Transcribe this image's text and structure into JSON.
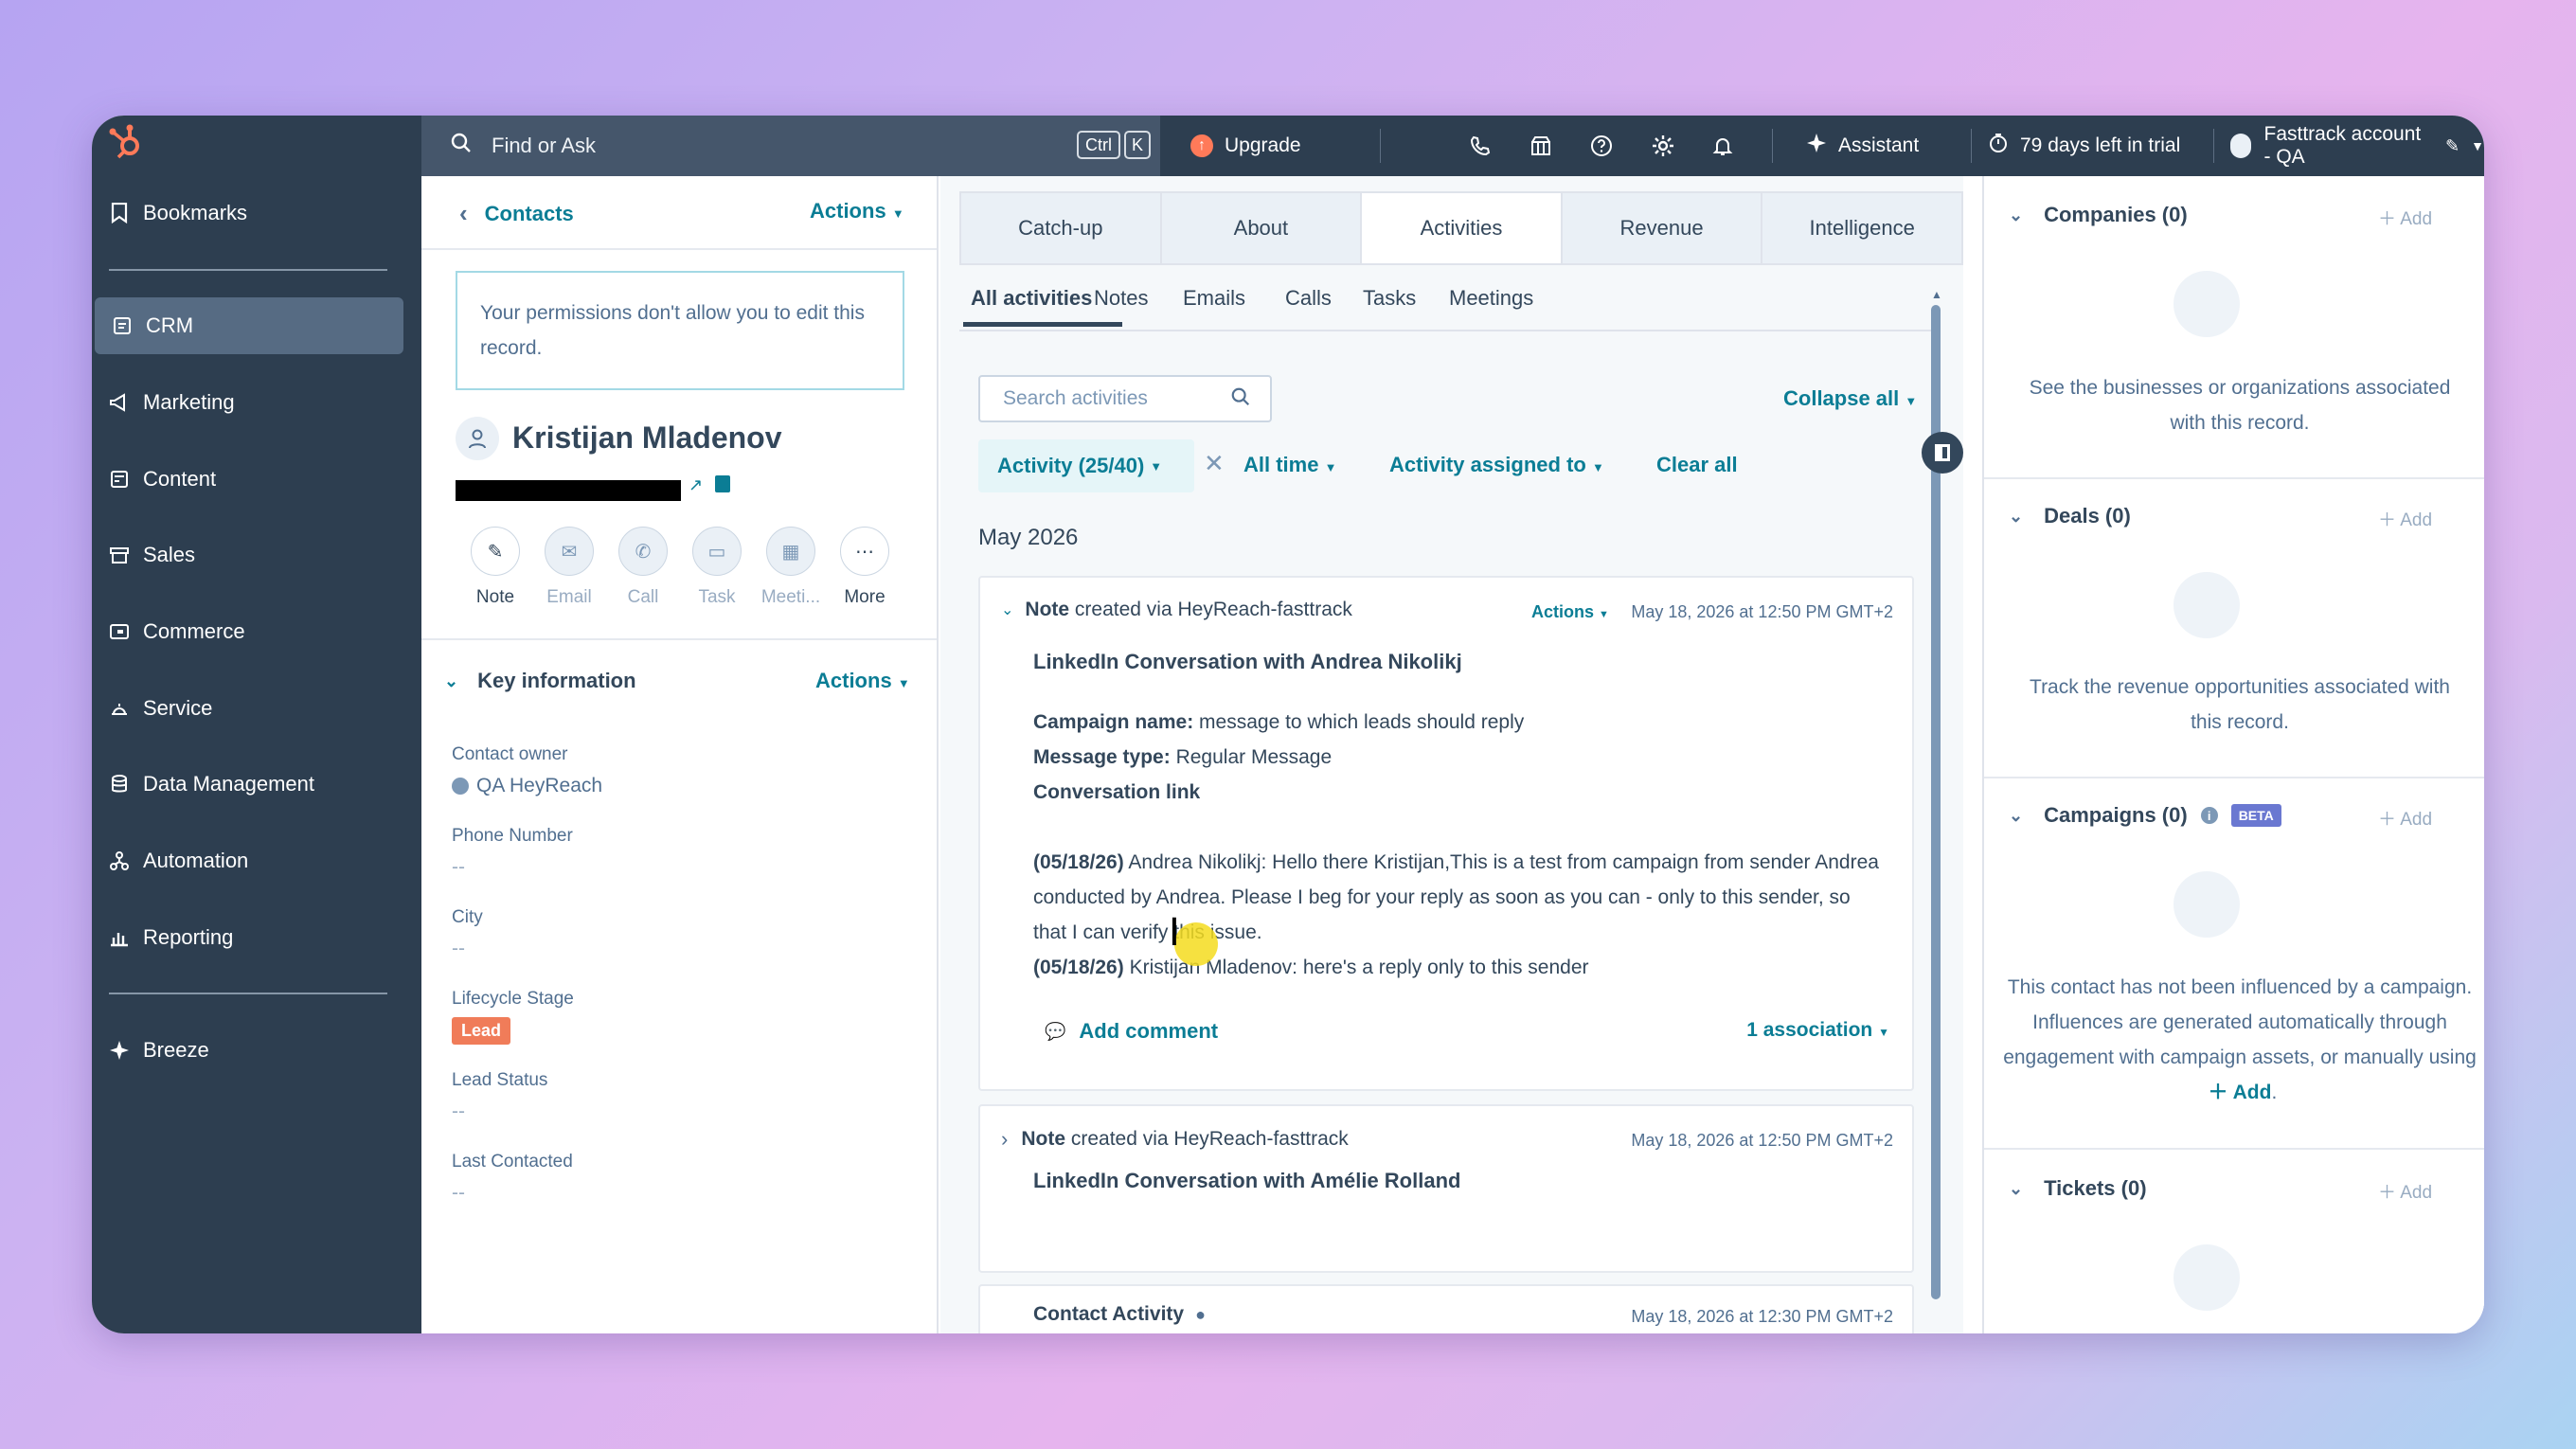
{
  "sidebar": {
    "items": [
      {
        "label": "Bookmarks",
        "icon": "bookmark-icon"
      },
      {
        "label": "CRM",
        "icon": "crm-icon"
      },
      {
        "label": "Marketing",
        "icon": "megaphone-icon"
      },
      {
        "label": "Content",
        "icon": "content-icon"
      },
      {
        "label": "Sales",
        "icon": "sales-icon"
      },
      {
        "label": "Commerce",
        "icon": "commerce-icon"
      },
      {
        "label": "Service",
        "icon": "service-icon"
      },
      {
        "label": "Data Management",
        "icon": "database-icon"
      },
      {
        "label": "Automation",
        "icon": "automation-icon"
      },
      {
        "label": "Reporting",
        "icon": "reporting-icon"
      },
      {
        "label": "Breeze",
        "icon": "sparkle-icon"
      }
    ]
  },
  "topbar": {
    "search_placeholder": "Find or Ask",
    "kbd_ctrl": "Ctrl",
    "kbd_k": "K",
    "upgrade": "Upgrade",
    "assistant": "Assistant",
    "trial": "79 days left in trial",
    "account": "Fasttrack account - QA"
  },
  "record": {
    "breadcrumb": "Contacts",
    "actions": "Actions",
    "permission_note": "Your permissions don't allow you to edit this record.",
    "name": "Kristijan Mladenov",
    "quick_actions": [
      "Note",
      "Email",
      "Call",
      "Task",
      "Meeti...",
      "More"
    ],
    "key_info_title": "Key information",
    "key_info_actions": "Actions",
    "fields": [
      {
        "label": "Contact owner",
        "value": "QA HeyReach"
      },
      {
        "label": "Phone Number",
        "value": "--"
      },
      {
        "label": "City",
        "value": "--"
      },
      {
        "label": "Lifecycle Stage",
        "value": "Lead"
      },
      {
        "label": "Lead Status",
        "value": "--"
      },
      {
        "label": "Last Contacted",
        "value": "--"
      }
    ]
  },
  "tabs": [
    "Catch-up",
    "About",
    "Activities",
    "Revenue",
    "Intelligence"
  ],
  "subtabs": [
    "All activities",
    "Notes",
    "Emails",
    "Calls",
    "Tasks",
    "Meetings"
  ],
  "activity": {
    "search_placeholder": "Search activities",
    "collapse": "Collapse all",
    "filter_activity": "Activity (25/40)",
    "filter_time": "All time",
    "filter_assigned": "Activity assigned to",
    "clear": "Clear all",
    "month": "May 2026",
    "note1": {
      "type": "Note",
      "via": "created via HeyReach-fasttrack",
      "actions": "Actions",
      "time": "May 18, 2026 at 12:50 PM GMT+2",
      "title": "LinkedIn Conversation with Andrea Nikolikj",
      "campaign_label": "Campaign name:",
      "campaign_value": "message to which leads should reply",
      "msgtype_label": "Message type:",
      "msgtype_value": "Regular Message",
      "conv_link": "Conversation link",
      "line1_date": "(05/18/26)",
      "line1_text": "Andrea Nikolikj: Hello there Kristijan,This is a test from campaign from sender Andrea conducted by Andrea. Please I beg for your reply as soon as you can - only to this sender, so that I can verify this issue.",
      "line2_date": "(05/18/26)",
      "line2_text": "Kristijan Mladenov: here's a reply only to this sender",
      "add_comment": "Add comment",
      "association": "1 association"
    },
    "note2": {
      "type": "Note",
      "via": "created via HeyReach-fasttrack",
      "time": "May 18, 2026 at 12:50 PM GMT+2",
      "title": "LinkedIn Conversation with Amélie Rolland"
    },
    "contact_activity": {
      "title": "Contact Activity",
      "time": "May 18, 2026 at 12:30 PM GMT+2"
    }
  },
  "right": {
    "add": "Add",
    "companies_title": "Companies (0)",
    "companies_desc": "See the businesses or organizations associated with this record.",
    "deals_title": "Deals (0)",
    "deals_desc": "Track the revenue opportunities associated with this record.",
    "campaigns_title": "Campaigns (0)",
    "beta": "BETA",
    "campaigns_desc": "This contact has not been influenced by a campaign. Influences are generated automatically through engagement with campaign assets, or manually using",
    "campaigns_add": "Add",
    "campaigns_dot": ".",
    "tickets_title": "Tickets (0)"
  },
  "colors": {
    "sidebar": "#2d3e50",
    "accent": "#0b7d95",
    "lead_badge": "#f07c59",
    "beta": "#6a78d1"
  }
}
